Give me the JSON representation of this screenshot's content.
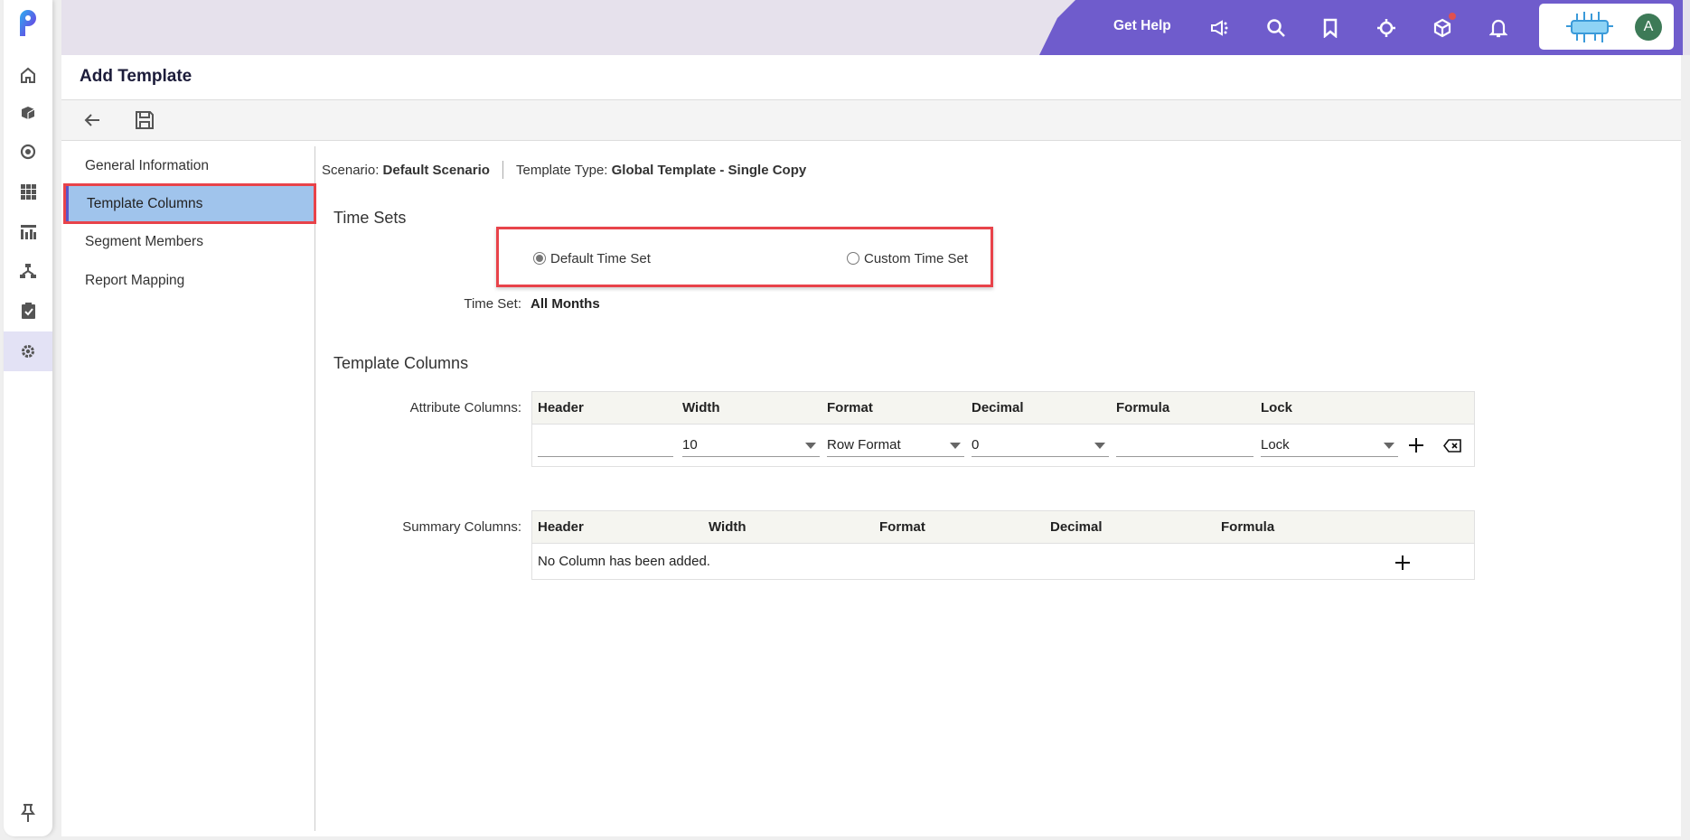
{
  "topbar": {
    "get_help": "Get Help",
    "avatar_initial": "A",
    "colors": {
      "accent": "#6f5ccc",
      "notification_dot": "#e05050"
    }
  },
  "rail": {
    "icons": [
      "logo-icon",
      "home-icon",
      "cube-icon",
      "target-icon",
      "grid-icon",
      "report-icon",
      "hierarchy-icon",
      "clipboard-check-icon",
      "settings-icon"
    ],
    "active": "settings-icon",
    "pin": "pin-icon"
  },
  "page": {
    "title": "Add Template"
  },
  "toolbar": {
    "back": "back-arrow-icon",
    "save": "save-icon"
  },
  "nav": {
    "items": [
      {
        "label": "General Information"
      },
      {
        "label": "Template Columns",
        "active": true
      },
      {
        "label": "Segment Members"
      },
      {
        "label": "Report Mapping"
      }
    ]
  },
  "info": {
    "scenario_label": "Scenario:",
    "scenario_value": "Default Scenario",
    "type_label": "Template Type:",
    "type_value": "Global Template - Single Copy"
  },
  "time_sets": {
    "heading": "Time Sets",
    "options": [
      {
        "label": "Default Time Set",
        "selected": true
      },
      {
        "label": "Custom Time Set",
        "selected": false
      }
    ],
    "time_set_label": "Time Set:",
    "time_set_value": "All Months"
  },
  "template_columns": {
    "heading": "Template Columns",
    "attribute": {
      "label": "Attribute Columns:",
      "headers": [
        "Header",
        "Width",
        "Format",
        "Decimal",
        "Formula",
        "Lock"
      ],
      "row": {
        "header": "",
        "width": "10",
        "format": "Row Format",
        "decimal": "0",
        "formula": "",
        "lock": "Lock"
      }
    },
    "summary": {
      "label": "Summary Columns:",
      "headers": [
        "Header",
        "Width",
        "Format",
        "Decimal",
        "Formula"
      ],
      "empty": "No Column has been added."
    }
  }
}
